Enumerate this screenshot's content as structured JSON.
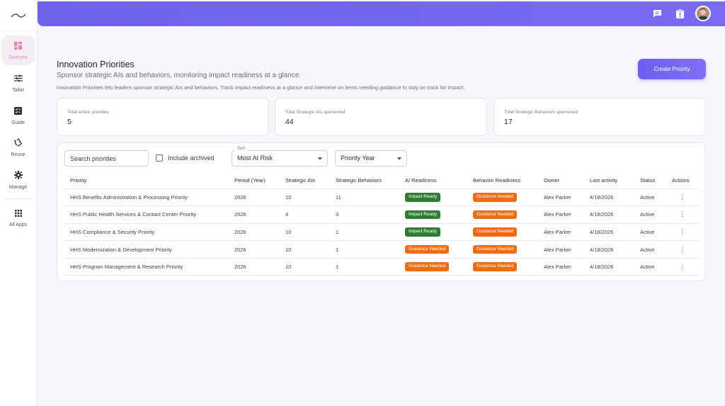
{
  "sidebar": {
    "logo_icon": "wave-logo-icon",
    "items": [
      {
        "label": "Oversee",
        "icon": "dashboard-icon",
        "active": true
      },
      {
        "label": "Tailor",
        "icon": "sliders-icon"
      },
      {
        "label": "Guide",
        "icon": "checklist-icon"
      },
      {
        "label": "Reuse",
        "icon": "recycle-icon"
      },
      {
        "label": "Manage",
        "icon": "gear-icon"
      },
      {
        "label": "All Apps",
        "icon": "grid-icon"
      }
    ]
  },
  "topbar": {
    "icons": [
      "chat-icon",
      "clipboard-icon"
    ],
    "avatar": "user-avatar",
    "accent": "#7366ee"
  },
  "page": {
    "title": "Innovation Priorities",
    "subtitle": "Sponsor strategic AIs and behaviors, monitoring impact readiness at a glance.",
    "description": "Innovation Priorities lets leaders sponsor strategic AIs and behaviors. Track impact readiness at a glance and intervene on items needing guidance to stay on track for impact.",
    "create_button": "Create Priority"
  },
  "stats": [
    {
      "label": "Total active priorities",
      "value": "5"
    },
    {
      "label": "Total Strategic AIs sponsored",
      "value": "44"
    },
    {
      "label": "Total Strategic Behaviors sponsored",
      "value": "17"
    }
  ],
  "filters": {
    "search_placeholder": "Search priorities",
    "include_archived": "Include archived",
    "sort_label": "Sort",
    "sort_value": "Most At Risk",
    "year_value": "Priority Year"
  },
  "table": {
    "headers": [
      "Priority",
      "Period (Year)",
      "Strategic AIs",
      "Strategic Behaviors",
      "AI Readiness",
      "Behavior Readiness",
      "Owner",
      "Last activity",
      "Status",
      "Actions"
    ],
    "rows": [
      {
        "priority": "HHS Benefits Administration & Processing Priority",
        "period": "2026",
        "ais": "10",
        "behaviors": "11",
        "ai_readiness": "Impact Ready",
        "behavior_readiness": "Guidance Needed",
        "owner": "Alex Parker",
        "last_activity": "4/18/2026",
        "status": "Active"
      },
      {
        "priority": "HHS Public Health Services & Contact Center Priority",
        "period": "2026",
        "ais": "4",
        "behaviors": "3",
        "ai_readiness": "Impact Ready",
        "behavior_readiness": "Guidance Needed",
        "owner": "Alex Parker",
        "last_activity": "4/18/2026",
        "status": "Active"
      },
      {
        "priority": "HHS Compliance & Security Priority",
        "period": "2026",
        "ais": "10",
        "behaviors": "1",
        "ai_readiness": "Impact Ready",
        "behavior_readiness": "Guidance Needed",
        "owner": "Alex Parker",
        "last_activity": "4/18/2026",
        "status": "Active"
      },
      {
        "priority": "HHS Modernization & Development Priority",
        "period": "2026",
        "ais": "10",
        "behaviors": "1",
        "ai_readiness": "Guidance Needed",
        "behavior_readiness": "Guidance Needed",
        "owner": "Alex Parker",
        "last_activity": "4/18/2026",
        "status": "Active"
      },
      {
        "priority": "HHS Program Management & Research Priority",
        "period": "2026",
        "ais": "10",
        "behaviors": "1",
        "ai_readiness": "Guidance Needed",
        "behavior_readiness": "Guidance Needed",
        "owner": "Alex Parker",
        "last_activity": "4/18/2026",
        "status": "Active"
      }
    ],
    "action_icon": "more-vertical-icon"
  },
  "colors": {
    "impact_ready": "#2f7d32",
    "guidance_needed": "#ef6c12",
    "active_nav": "#ef7fb0"
  }
}
